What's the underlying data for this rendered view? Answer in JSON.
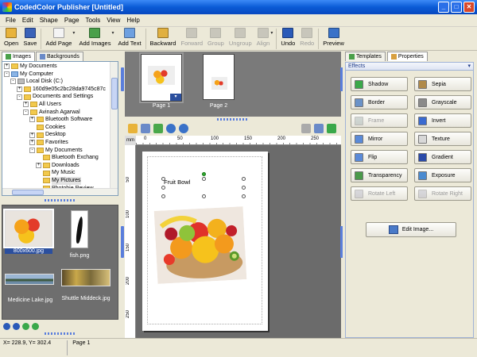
{
  "window": {
    "title": "CodedColor Publisher [Untitled]"
  },
  "menu": [
    "File",
    "Edit",
    "Shape",
    "Page",
    "Tools",
    "View",
    "Help"
  ],
  "toolbar": [
    {
      "label": "Open",
      "icon": "open-folder-icon",
      "color": "#e8b33a",
      "enabled": true
    },
    {
      "label": "Save",
      "icon": "save-disk-icon",
      "color": "#3a62b8",
      "enabled": true
    },
    {
      "label": "Add Page",
      "icon": "add-page-icon",
      "color": "#f4f4f4",
      "enabled": true
    },
    {
      "label": "Add Images",
      "icon": "add-image-icon",
      "color": "#4aa04a",
      "enabled": true
    },
    {
      "label": "Add Text",
      "icon": "add-text-icon",
      "color": "#6ea0e0",
      "enabled": true
    },
    {
      "label": "Backward",
      "icon": "send-backward-icon",
      "color": "#e0b040",
      "enabled": true
    },
    {
      "label": "Forward",
      "icon": "bring-forward-icon",
      "color": "#888",
      "enabled": false
    },
    {
      "label": "Group",
      "icon": "group-icon",
      "color": "#888",
      "enabled": false
    },
    {
      "label": "Ungroup",
      "icon": "ungroup-icon",
      "color": "#888",
      "enabled": false
    },
    {
      "label": "Align",
      "icon": "align-icon",
      "color": "#888",
      "enabled": false
    },
    {
      "label": "Undo",
      "icon": "undo-icon",
      "color": "#2a5ab8",
      "enabled": true
    },
    {
      "label": "Redo",
      "icon": "redo-icon",
      "color": "#888",
      "enabled": false
    },
    {
      "label": "Preview",
      "icon": "preview-magnifier-icon",
      "color": "#3a72c8",
      "enabled": true
    }
  ],
  "left_panel": {
    "tabs": [
      "Images",
      "Backgrounds"
    ],
    "tree": [
      {
        "label": "My Documents",
        "depth": 0,
        "exp": "+",
        "kind": "fld"
      },
      {
        "label": "My Computer",
        "depth": 0,
        "exp": "-",
        "kind": "pc"
      },
      {
        "label": "Local Disk (C:)",
        "depth": 1,
        "exp": "-",
        "kind": "dk"
      },
      {
        "label": "160d9e05c2bc28da9745c87c",
        "depth": 2,
        "exp": "+",
        "kind": "fld"
      },
      {
        "label": "Documents and Settings",
        "depth": 2,
        "exp": "-",
        "kind": "fld"
      },
      {
        "label": "All Users",
        "depth": 3,
        "exp": "+",
        "kind": "fld"
      },
      {
        "label": "Avinash Agarwal",
        "depth": 3,
        "exp": "-",
        "kind": "fld"
      },
      {
        "label": "Bluetooth Software",
        "depth": 4,
        "exp": "+",
        "kind": "fld"
      },
      {
        "label": "Cookies",
        "depth": 4,
        "exp": "",
        "kind": "fld"
      },
      {
        "label": "Desktop",
        "depth": 4,
        "exp": "+",
        "kind": "fld"
      },
      {
        "label": "Favorites",
        "depth": 4,
        "exp": "+",
        "kind": "fld"
      },
      {
        "label": "My Documents",
        "depth": 4,
        "exp": "-",
        "kind": "fld"
      },
      {
        "label": "Bluetooth Exchang",
        "depth": 5,
        "exp": "",
        "kind": "fld"
      },
      {
        "label": "Downloads",
        "depth": 5,
        "exp": "+",
        "kind": "fld"
      },
      {
        "label": "My Music",
        "depth": 5,
        "exp": "",
        "kind": "fld"
      },
      {
        "label": "My Pictures",
        "depth": 5,
        "exp": "",
        "kind": "fld",
        "selected": true
      },
      {
        "label": "Photobie Review",
        "depth": 5,
        "exp": "",
        "kind": "fld"
      }
    ],
    "gallery": [
      {
        "label": "800x600.jpg",
        "selected": true
      },
      {
        "label": "fish.png"
      },
      {
        "label": "Medicine Lake.jpg"
      },
      {
        "label": "Shuttle Middeck.jpg"
      }
    ]
  },
  "pages": [
    {
      "label": "Page 1"
    },
    {
      "label": "Page 2"
    }
  ],
  "ruler": {
    "h": [
      "mm",
      "0",
      "50",
      "100",
      "150",
      "200",
      "250"
    ],
    "v": [
      "50",
      "100",
      "150",
      "200",
      "250"
    ]
  },
  "canvas": {
    "text_box": "Fruit Bowl"
  },
  "right_panel": {
    "tabs": [
      "Templates",
      "Properties"
    ],
    "section": "Effects",
    "effects": [
      {
        "label": "Shadow",
        "enabled": true,
        "color": "#3aa84a"
      },
      {
        "label": "Sepia",
        "enabled": true,
        "color": "#b08a4a"
      },
      {
        "label": "Border",
        "enabled": true,
        "color": "#6a92c8"
      },
      {
        "label": "Grayscale",
        "enabled": true,
        "color": "#8a8a8a"
      },
      {
        "label": "Frame",
        "enabled": false,
        "color": "#9aa"
      },
      {
        "label": "Invert",
        "enabled": true,
        "color": "#3a6ad0"
      },
      {
        "label": "Mirror",
        "enabled": true,
        "color": "#5a8ad8"
      },
      {
        "label": "Texture",
        "enabled": true,
        "color": "#d8d8d8"
      },
      {
        "label": "Flip",
        "enabled": true,
        "color": "#5a8ad8"
      },
      {
        "label": "Gradient",
        "enabled": true,
        "color": "#2a4aa8"
      },
      {
        "label": "Transparency",
        "enabled": true,
        "color": "#4a9a4a"
      },
      {
        "label": "Exposure",
        "enabled": true,
        "color": "#4a8ad0"
      },
      {
        "label": "Rotate Left",
        "enabled": false,
        "color": "#aab"
      },
      {
        "label": "Rotate Right",
        "enabled": false,
        "color": "#aab"
      }
    ],
    "edit_button": "Edit Image..."
  },
  "status": {
    "coords": "X= 228.9, Y= 302.4",
    "page": "Page 1"
  }
}
